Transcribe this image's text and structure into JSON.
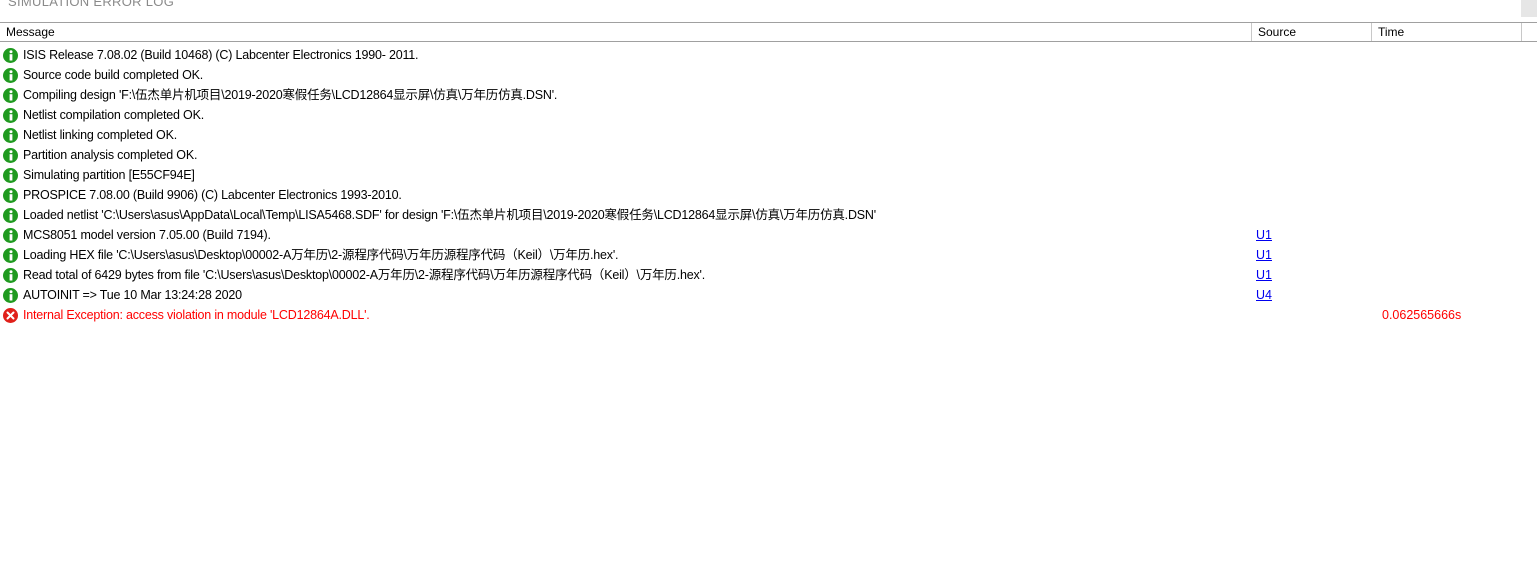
{
  "window": {
    "title": "SIMULATION ERROR LOG"
  },
  "columns": {
    "message": "Message",
    "source": "Source",
    "time": "Time"
  },
  "colors": {
    "info_icon": "#1f9a1f",
    "error_icon": "#e0201a",
    "error_text": "#ff0000",
    "link": "#0000ee"
  },
  "rows": [
    {
      "type": "info",
      "icon": "info-icon",
      "message": "ISIS Release 7.08.02 (Build 10468) (C) Labcenter Electronics 1990- 2011.",
      "source": "",
      "time": ""
    },
    {
      "type": "info",
      "icon": "info-icon",
      "message": "Source code build completed OK.",
      "source": "",
      "time": ""
    },
    {
      "type": "info",
      "icon": "info-icon",
      "message": "Compiling design 'F:\\伍杰单片机项目\\2019-2020寒假任务\\LCD12864显示屏\\仿真\\万年历仿真.DSN'.",
      "source": "",
      "time": ""
    },
    {
      "type": "info",
      "icon": "info-icon",
      "message": "Netlist compilation completed OK.",
      "source": "",
      "time": ""
    },
    {
      "type": "info",
      "icon": "info-icon",
      "message": "Netlist linking completed OK.",
      "source": "",
      "time": ""
    },
    {
      "type": "info",
      "icon": "info-icon",
      "message": "Partition analysis completed OK.",
      "source": "",
      "time": ""
    },
    {
      "type": "info",
      "icon": "info-icon",
      "message": "Simulating partition [E55CF94E]",
      "source": "",
      "time": ""
    },
    {
      "type": "info",
      "icon": "info-icon",
      "message": "PROSPICE 7.08.00 (Build 9906) (C) Labcenter Electronics 1993-2010.",
      "source": "",
      "time": ""
    },
    {
      "type": "info",
      "icon": "info-icon",
      "message": "Loaded netlist 'C:\\Users\\asus\\AppData\\Local\\Temp\\LISA5468.SDF' for design 'F:\\伍杰单片机项目\\2019-2020寒假任务\\LCD12864显示屏\\仿真\\万年历仿真.DSN'",
      "source": "",
      "time": ""
    },
    {
      "type": "info",
      "icon": "info-icon",
      "message": "MCS8051 model version 7.05.00 (Build 7194).",
      "source": "U1",
      "time": ""
    },
    {
      "type": "info",
      "icon": "info-icon",
      "message": "Loading HEX file 'C:\\Users\\asus\\Desktop\\00002-A万年历\\2-源程序代码\\万年历源程序代码（Keil）\\万年历.hex'.",
      "source": "U1",
      "time": ""
    },
    {
      "type": "info",
      "icon": "info-icon",
      "message": "Read total of 6429 bytes from file 'C:\\Users\\asus\\Desktop\\00002-A万年历\\2-源程序代码\\万年历源程序代码（Keil）\\万年历.hex'.",
      "source": "U1",
      "time": ""
    },
    {
      "type": "info",
      "icon": "info-icon",
      "message": "AUTOINIT => Tue 10 Mar 13:24:28 2020",
      "source": "U4",
      "time": ""
    },
    {
      "type": "error",
      "icon": "error-icon",
      "message": "Internal Exception: access violation in module 'LCD12864A.DLL'.",
      "source": "",
      "time": "0.062565666s"
    }
  ]
}
